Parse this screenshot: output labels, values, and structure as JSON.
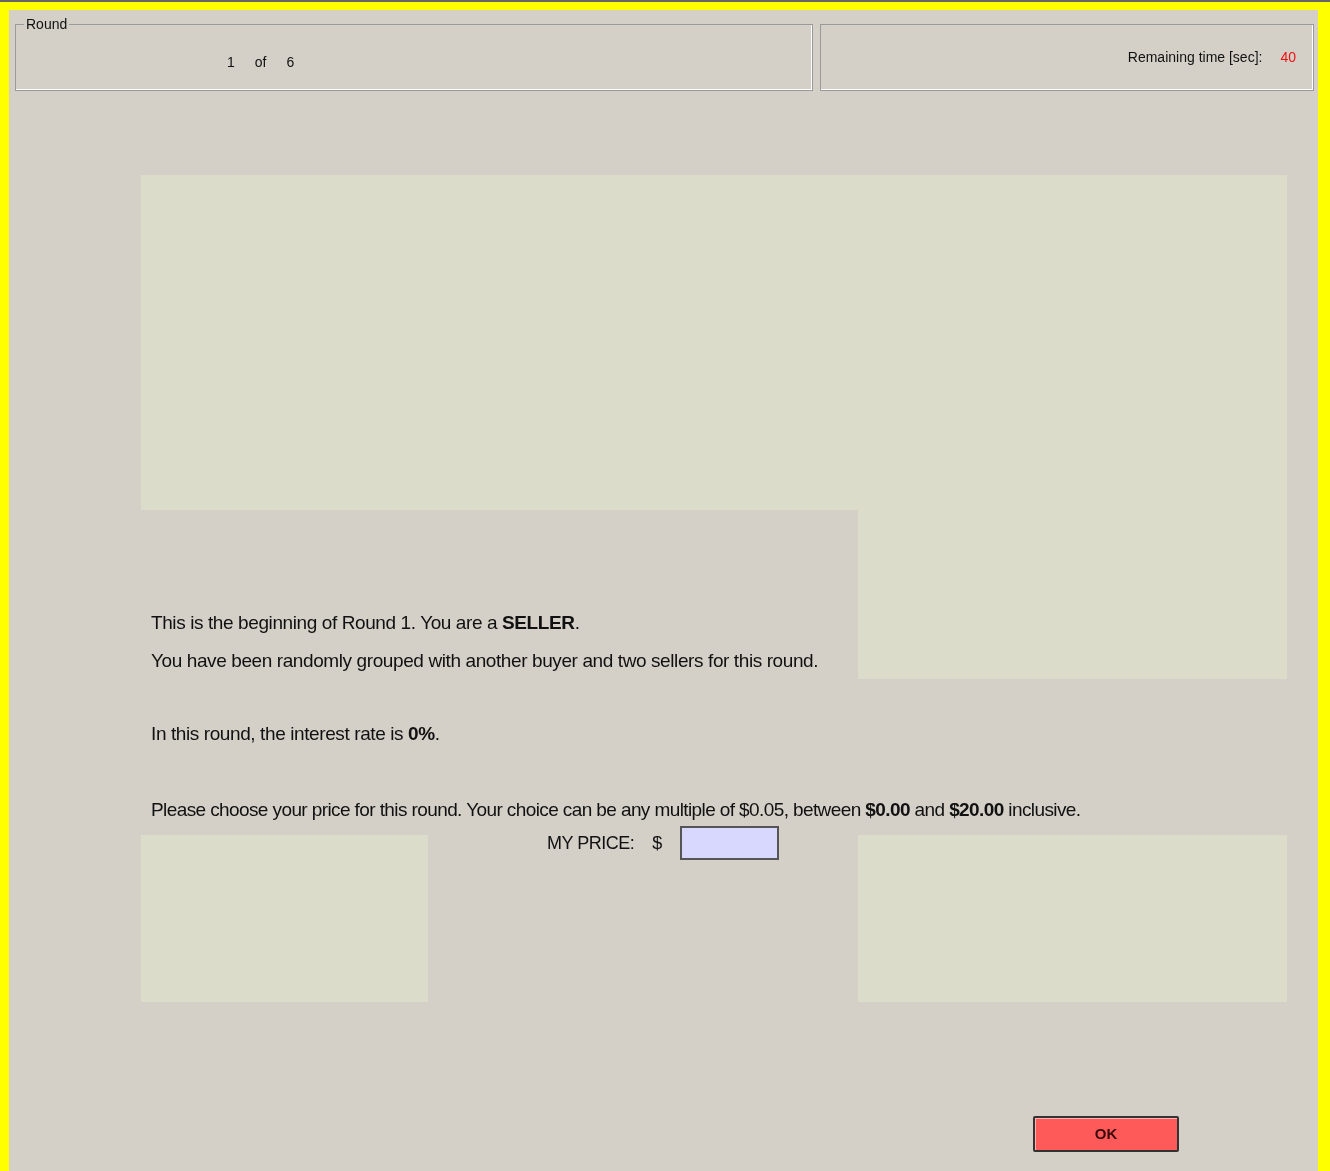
{
  "round_box": {
    "title": "Round",
    "current": "1",
    "of": "of",
    "total": "6"
  },
  "timer_box": {
    "label": "Remaining time [sec]:",
    "value": "40"
  },
  "intro_lines": [
    "This is the beginning of Round 1. You are a **SELLER**.",
    "You have been randomly grouped with another buyer and two sellers for this round."
  ],
  "interest_line": "In this round, the interest rate is **0%**.",
  "price_prompt": "Please choose your price for this round. Your choice can be any multiple of $0.05, between **$0.00** and **$20.00** inclusive.",
  "price_field": {
    "label": "MY PRICE:",
    "currency": "$"
  },
  "ok_button": "OK"
}
